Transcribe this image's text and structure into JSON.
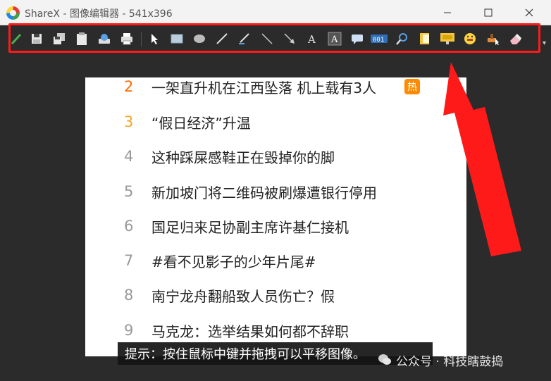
{
  "window": {
    "title": "ShareX - 图像编辑器 - 541x396",
    "minimize_icon": "minimize-icon",
    "maximize_icon": "maximize-icon",
    "close_icon": "close-icon"
  },
  "toolbar": {
    "tools": [
      {
        "id": "color",
        "icon": "pen-color-icon"
      },
      {
        "id": "save",
        "icon": "save-icon"
      },
      {
        "id": "save-as",
        "icon": "save-as-icon"
      },
      {
        "id": "copy",
        "icon": "clipboard-icon"
      },
      {
        "id": "upload",
        "icon": "upload-icon"
      },
      {
        "id": "print",
        "icon": "print-icon"
      },
      {
        "id": "select",
        "icon": "cursor-icon"
      },
      {
        "id": "rectangle",
        "icon": "rectangle-icon"
      },
      {
        "id": "ellipse",
        "icon": "ellipse-icon"
      },
      {
        "id": "freehand",
        "icon": "freehand-icon"
      },
      {
        "id": "smart-eraser",
        "icon": "freehand-arrow-icon"
      },
      {
        "id": "line",
        "icon": "line-icon"
      },
      {
        "id": "arrow",
        "icon": "arrow-icon"
      },
      {
        "id": "text",
        "icon": "text-icon"
      },
      {
        "id": "text-background",
        "icon": "text-background-icon"
      },
      {
        "id": "speech-balloon",
        "icon": "speech-balloon-icon"
      },
      {
        "id": "step",
        "icon": "step-counter-icon"
      },
      {
        "id": "magnify",
        "icon": "magnify-icon"
      },
      {
        "id": "image",
        "icon": "image-file-icon"
      },
      {
        "id": "image-screen",
        "icon": "image-screen-icon"
      },
      {
        "id": "sticker",
        "icon": "emoji-sticker-icon"
      },
      {
        "id": "cursor-insert",
        "icon": "cursor-insert-icon"
      },
      {
        "id": "eraser",
        "icon": "eraser-icon"
      }
    ],
    "step_label": "001",
    "overflow_icon": "chevron-down-icon"
  },
  "annotation": {
    "highlight_color": "#ff1a1a",
    "arrow_color": "#ff1a1a"
  },
  "canvas": {
    "items": [
      {
        "rank": "2",
        "text": "一架直升机在江西坠落 机上载有3人",
        "rank_color": "#ff6a00",
        "badge": "热"
      },
      {
        "rank": "3",
        "text": "“假日经济”升温",
        "rank_color": "#f5a623",
        "badge": ""
      },
      {
        "rank": "4",
        "text": "这种踩屎感鞋正在毁掉你的脚",
        "rank_color": "#999999",
        "badge": ""
      },
      {
        "rank": "5",
        "text": "新加坡门将二维码被刷爆遭银行停用",
        "rank_color": "#999999",
        "badge": ""
      },
      {
        "rank": "6",
        "text": "国足归来足协副主席许基仁接机",
        "rank_color": "#999999",
        "badge": ""
      },
      {
        "rank": "7",
        "text": "#看不见影子的少年片尾#",
        "rank_color": "#999999",
        "badge": ""
      },
      {
        "rank": "8",
        "text": "南宁龙舟翻船致人员伤亡？假",
        "rank_color": "#999999",
        "badge": ""
      },
      {
        "rank": "9",
        "text": "马克龙：选举结果如何都不辞职",
        "rank_color": "#999999",
        "badge": ""
      }
    ],
    "hint": "提示：按住鼠标中键并拖拽可以平移图像。"
  },
  "watermark": {
    "text": "公众号 · 科技瞎鼓捣",
    "icon": "wechat-icon"
  }
}
